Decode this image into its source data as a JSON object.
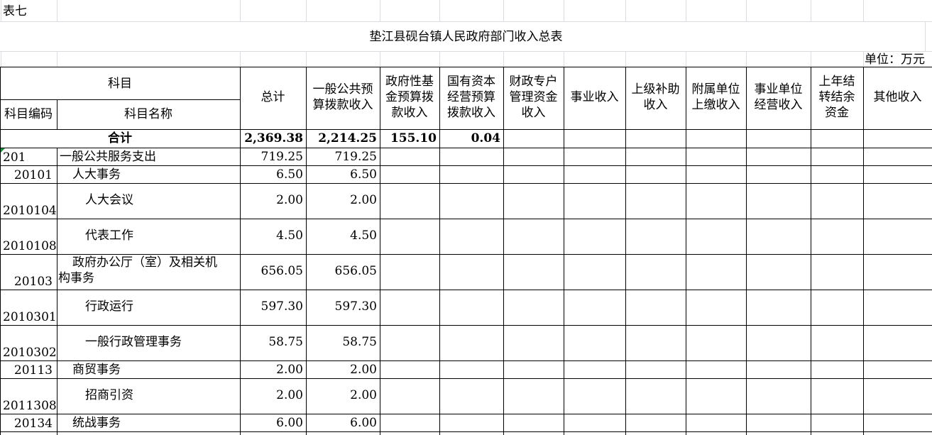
{
  "table_label": "表七",
  "title": "垫江县砚台镇人民政府部门收入总表",
  "unit": "单位：万元",
  "header": {
    "group_label": "科目",
    "code_label": "科目编码",
    "name_label": "科目名称",
    "columns": [
      [
        "总计"
      ],
      [
        "一般公共预",
        "算拨款收入"
      ],
      [
        "政府性基",
        "金预算拨",
        "款收入"
      ],
      [
        "国有资本",
        "经营预算",
        "拨款收入"
      ],
      [
        "财政专户",
        "管理资金",
        "收入"
      ],
      [
        "事业收入"
      ],
      [
        "上级补助",
        "收入"
      ],
      [
        "附属单位",
        "上缴收入"
      ],
      [
        "事业单位",
        "经营收入"
      ],
      [
        "上年结",
        "转结余",
        "资金"
      ],
      [
        "其他收入"
      ]
    ]
  },
  "total_row": {
    "label": "合计",
    "values": [
      "2,369.38",
      "2,214.25",
      "155.10",
      "0.04",
      "",
      "",
      "",
      "",
      "",
      "",
      ""
    ]
  },
  "rows": [
    {
      "code": "201",
      "name": [
        "一般公共服务支出"
      ],
      "total": "719.25",
      "general": "719.25"
    },
    {
      "code": "20101",
      "name": [
        "人大事务"
      ],
      "total": "6.50",
      "general": "6.50"
    },
    {
      "code": "2010104",
      "name": [
        "人大会议"
      ],
      "total": "2.00",
      "general": "2.00"
    },
    {
      "code": "2010108",
      "name": [
        "代表工作"
      ],
      "total": "4.50",
      "general": "4.50"
    },
    {
      "code": "20103",
      "name": [
        "政府办公厅（室）及相关机",
        "构事务"
      ],
      "total": "656.05",
      "general": "656.05"
    },
    {
      "code": "2010301",
      "name": [
        "行政运行"
      ],
      "total": "597.30",
      "general": "597.30"
    },
    {
      "code": "2010302",
      "name": [
        "一般行政管理事务"
      ],
      "total": "58.75",
      "general": "58.75"
    },
    {
      "code": "20113",
      "name": [
        "商贸事务"
      ],
      "total": "2.00",
      "general": "2.00"
    },
    {
      "code": "2011308",
      "name": [
        "招商引资"
      ],
      "total": "2.00",
      "general": "2.00"
    },
    {
      "code": "20134",
      "name": [
        "统战事务"
      ],
      "total": "6.00",
      "general": "6.00"
    }
  ]
}
